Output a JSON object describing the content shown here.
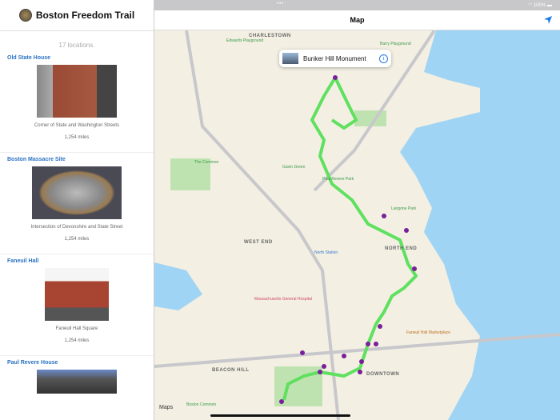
{
  "sidebar": {
    "title": "Boston Freedom Trail",
    "count": "17 locations.",
    "locations": [
      {
        "name": "Old State House",
        "address": "Corner of State and Washington Streets",
        "distance": "1,254 miles"
      },
      {
        "name": "Boston Massacre Site",
        "address": "Intersection of Devonshire and State Street",
        "distance": "1,254 miles"
      },
      {
        "name": "Faneuil Hall",
        "address": "Faneuil Hall Square",
        "distance": "1,254 miles"
      },
      {
        "name": "Paul Revere House"
      }
    ]
  },
  "status": {
    "battery": "100%"
  },
  "nav": {
    "title": "Map",
    "locate_icon": "location-arrow-icon"
  },
  "map": {
    "callout": "Bunker Hill Monument",
    "neighborhoods": [
      "CHARLESTOWN",
      "NORTH END",
      "DOWNTOWN",
      "BEACON HILL",
      "WEST END"
    ],
    "pois": [
      "Edwards Playground",
      "Barry Playground",
      "Paul Revere Park",
      "Langone Park",
      "The Common",
      "Gavin Green",
      "Massachusetts General Hospital",
      "North Station",
      "Boston Common",
      "Faneuil Hall Marketplace"
    ],
    "legal": "Maps",
    "colors": {
      "route": "#5fe05f",
      "water": "#9fd4f4",
      "pin": "#7a1f9a",
      "park": "#bfe3b0"
    }
  }
}
